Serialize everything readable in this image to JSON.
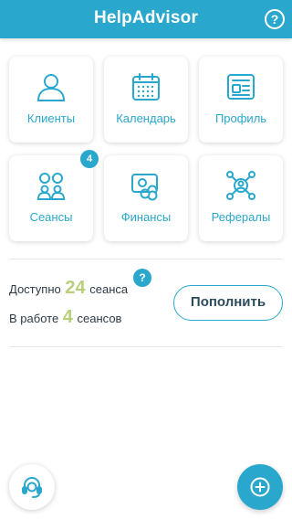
{
  "header": {
    "title": "HelpAdvisor",
    "help_glyph": "?"
  },
  "tiles": [
    {
      "label": "Клиенты",
      "icon": "user-icon"
    },
    {
      "label": "Календарь",
      "icon": "calendar-icon"
    },
    {
      "label": "Профиль",
      "icon": "profile-card-icon"
    },
    {
      "label": "Сеансы",
      "icon": "sessions-users-icon",
      "badge": "4"
    },
    {
      "label": "Финансы",
      "icon": "finance-icon"
    },
    {
      "label": "Рефералы",
      "icon": "referrals-network-icon"
    }
  ],
  "stats": {
    "available_prefix": "Доступно",
    "available_count": "24",
    "available_suffix": "сеанса",
    "in_progress_prefix": "В работе",
    "in_progress_count": "4",
    "in_progress_suffix": "сеансов",
    "info_glyph": "?"
  },
  "topup_label": "Пополнить",
  "bottom": {
    "support_icon": "headset-icon",
    "add_icon": "plus-circle-icon"
  },
  "colors": {
    "accent": "#2aa7cc",
    "count_green": "#b9cf7c"
  }
}
